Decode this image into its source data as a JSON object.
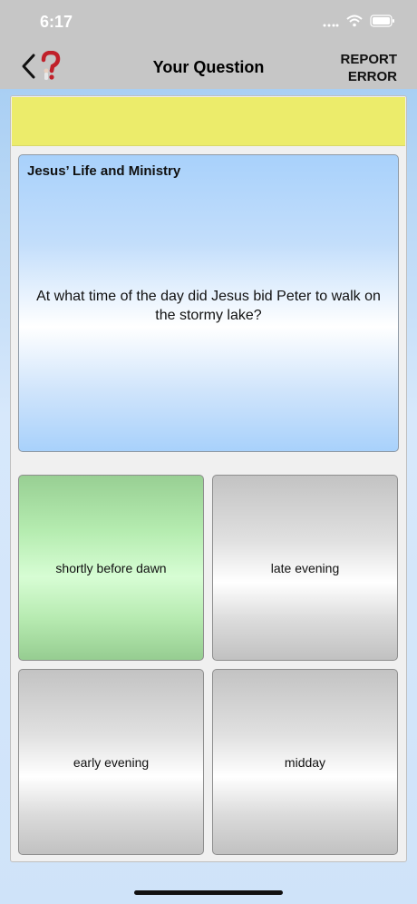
{
  "status_bar": {
    "time": "6:17",
    "icons": [
      "cellular-icon",
      "wifi-icon",
      "battery-icon"
    ]
  },
  "nav": {
    "back_icon": "chevron-left-icon",
    "logo_icon": "question-mark-logo-icon",
    "title": "Your Question",
    "report_line1": "REPORT",
    "report_line2": "ERROR"
  },
  "question": {
    "category": "Jesus’ Life and Ministry",
    "text": "At what time of the day did Jesus bid Peter to walk on the stormy lake?"
  },
  "answers": [
    {
      "label": "shortly before dawn",
      "state": "correct"
    },
    {
      "label": "late evening",
      "state": "neutral"
    },
    {
      "label": "early evening",
      "state": "neutral"
    },
    {
      "label": "midday",
      "state": "neutral"
    }
  ],
  "colors": {
    "banner": "#ecec6b",
    "correct": "#b5ecb0",
    "question_bg": "#a8d1fb",
    "nav_bg": "#c6c6c6"
  }
}
